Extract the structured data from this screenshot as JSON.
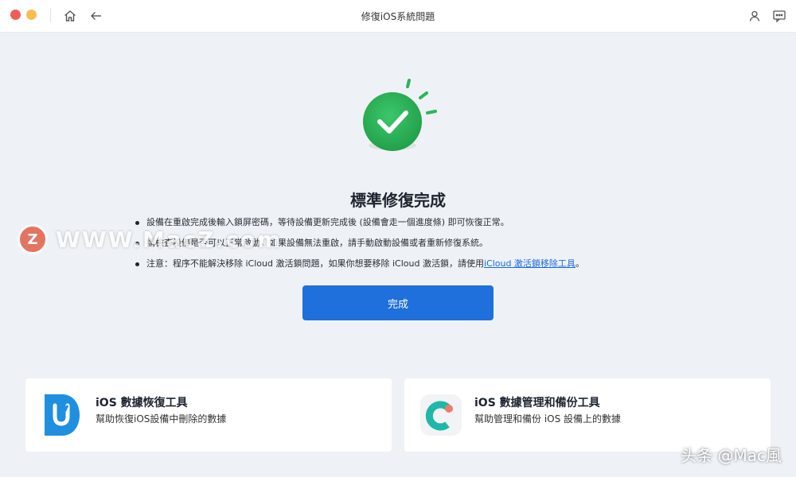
{
  "window": {
    "title": "修復iOS系統問題"
  },
  "colors": {
    "accent": "#1f6fdc",
    "success": "#2fb45a",
    "background": "#eef2f6"
  },
  "result": {
    "title": "標準修復完成",
    "bullets": [
      "設備在重啟完成後輸入鎖屏密碼，等待設備更新完成後 (設備會走一個進度條) 即可恢復正常。",
      "請檢查設備是否可以正常啟動，如果設備無法重啟，請手動啟動設備或者重新修復系統。"
    ],
    "note_prefix": "注意：程序不能解決移除 iCloud 激活鎖問題，如果你想要移除 iCloud 激活鎖，請使用",
    "note_link": "iCloud 激活鎖移除工具",
    "note_suffix": "。",
    "done_label": "完成"
  },
  "watermark": {
    "text": "WWW.MacZ.com",
    "badge": "Z"
  },
  "cards": [
    {
      "title": "iOS 數據恢復工具",
      "desc": "幫助恢復iOS設備中刪除的數據",
      "icon": "data-recovery-logo"
    },
    {
      "title": "iOS 數據管理和備份工具",
      "desc": "幫助管理和備份 iOS 設備上的數據",
      "icon": "data-manager-logo"
    }
  ],
  "footer_watermark": "头条 @Mac風"
}
